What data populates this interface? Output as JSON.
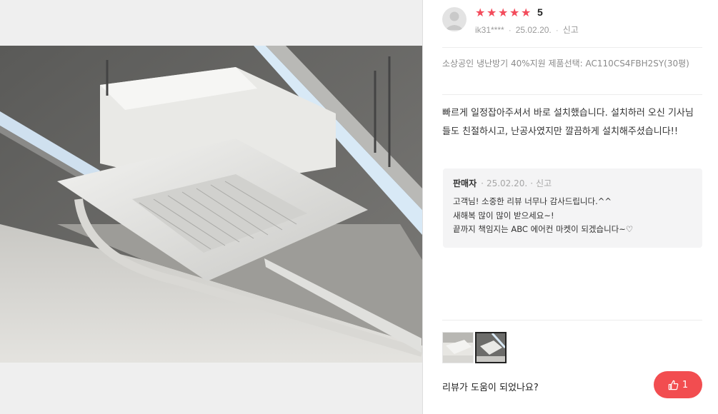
{
  "reviewer": {
    "avatar_icon": "user-avatar-icon",
    "rating": "5",
    "stars": 5,
    "star_color": "#f34b5b",
    "username": "ik31****",
    "date": "25.02.20.",
    "report": "신고"
  },
  "option": {
    "text": "소상공인 냉난방기 40%지원 제품선택: AC110CS4FBH2SY(30평)"
  },
  "review": {
    "body": "빠르게 일정잡아주셔서 바로 설치했습니다. 설치하러 오신 기사님들도 친절하시고, 난공사였지만 깔끔하게 설치해주셨습니다!!"
  },
  "seller_reply": {
    "author": "판매자",
    "date": "25.02.20.",
    "report": "신고",
    "lines": [
      "고객님! 소중한 리뷰 너무나 감사드립니다.^^",
      "새해복 많이 많이 받으세요~!",
      "끝까지 책임지는 ABC 에어컨 마켓이 되겠습니다~♡"
    ]
  },
  "footer": {
    "helpful_question": "리뷰가 도움이 되었나요?",
    "like_count": "1",
    "like_color": "#f24d50"
  }
}
